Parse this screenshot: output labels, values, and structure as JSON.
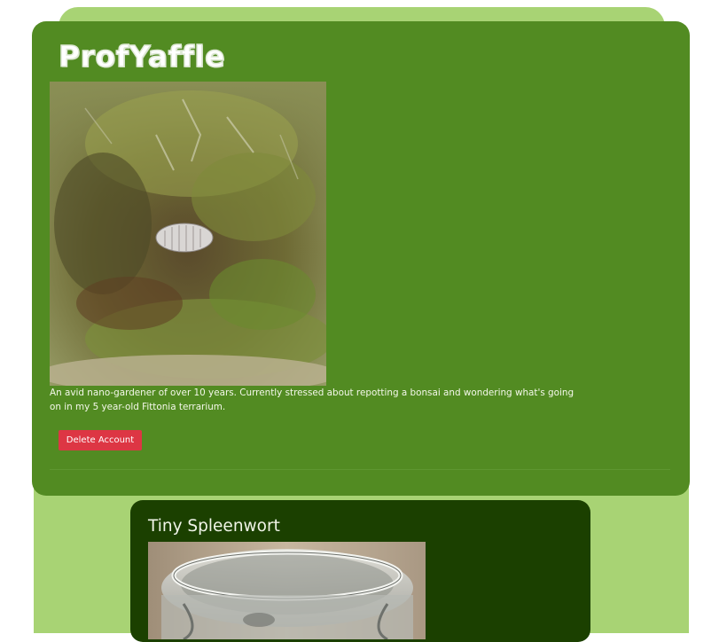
{
  "profile": {
    "username": "ProfYaffle",
    "bio": "An avid nano-gardener of over 10 years. Currently stressed about repotting a bonsai and wondering what's going on in my 5 year-old Fittonia terrarium.",
    "delete_label": "Delete Account"
  },
  "plants": [
    {
      "name": "Tiny Spleenwort"
    }
  ],
  "colors": {
    "page_background": "#a8d374",
    "profile_card": "#528b22",
    "plant_card": "#1b4000",
    "delete_button": "#dd3644"
  }
}
